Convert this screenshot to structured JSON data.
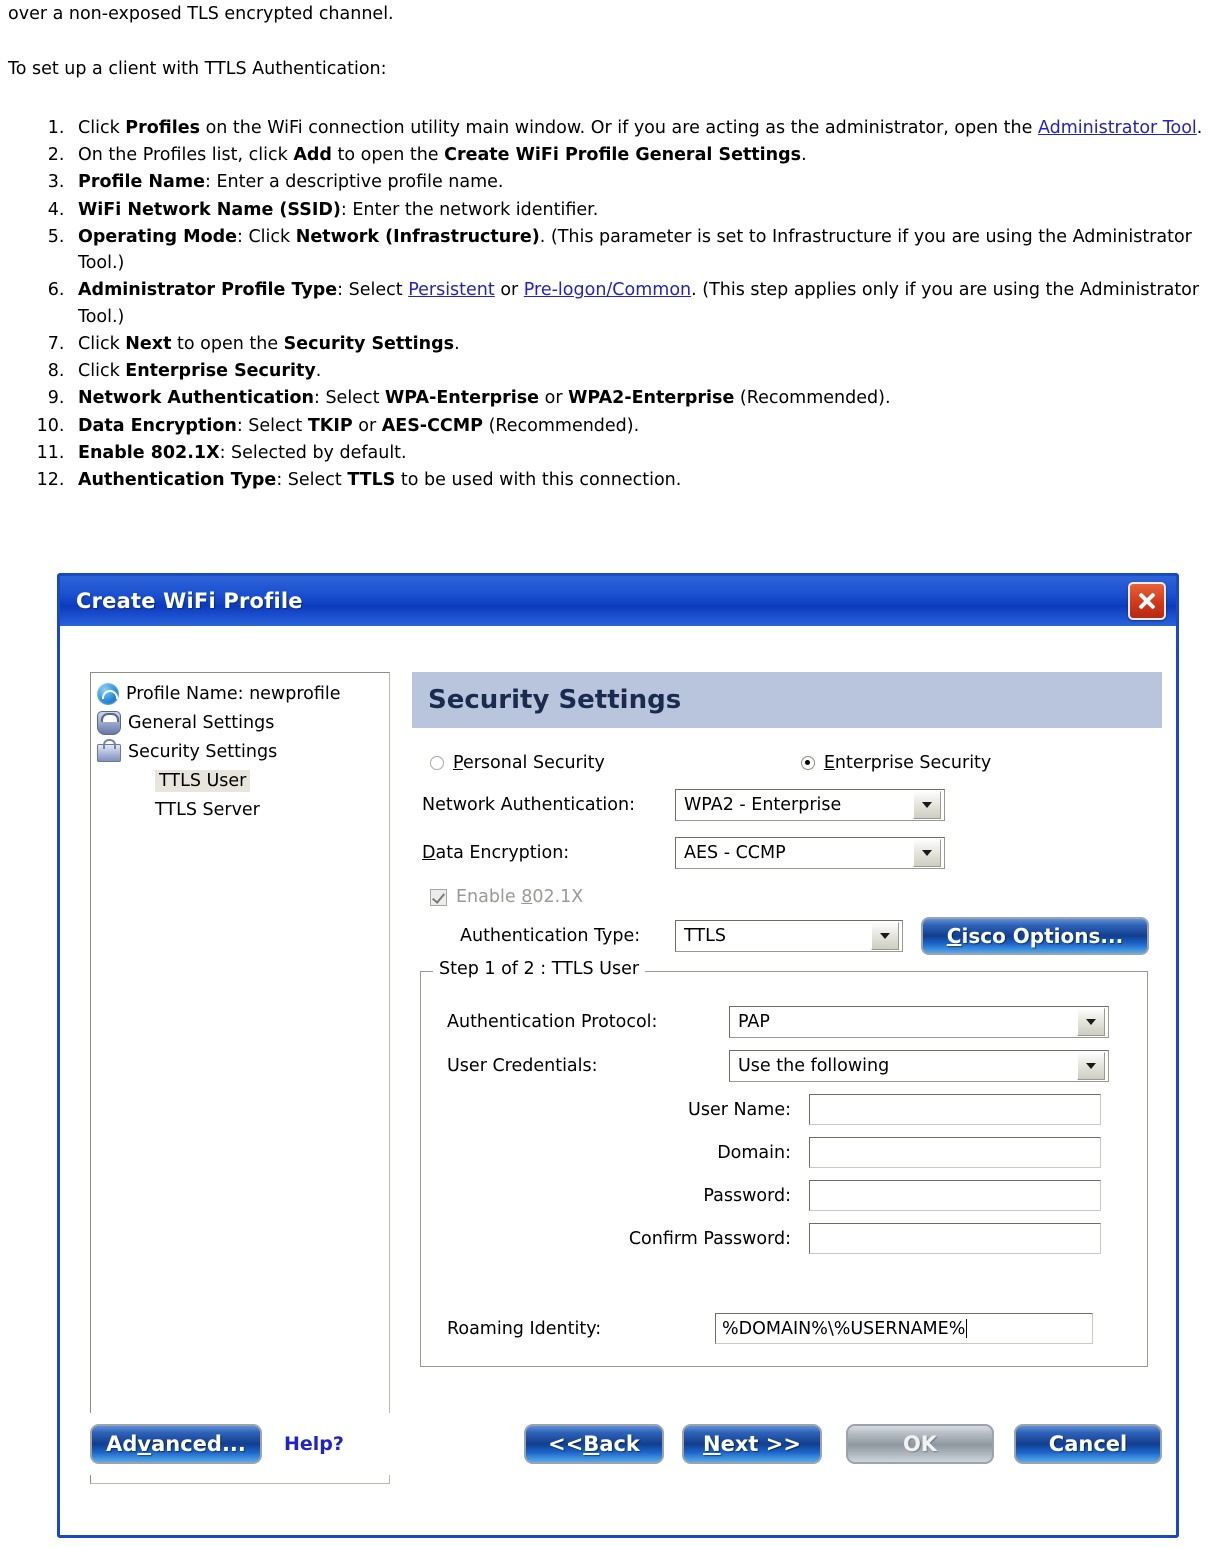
{
  "document": {
    "lead_line_1": "over a non-exposed TLS encrypted channel.",
    "lead_line_2": "To set up a client with TTLS Authentication:",
    "steps": [
      {
        "segments": [
          {
            "t": "Click ",
            "s": "normal"
          },
          {
            "t": "Profiles",
            "s": "bold"
          },
          {
            "t": " on the WiFi connection utility main window. Or if you are acting as the administrator, open the ",
            "s": "normal"
          },
          {
            "t": "Administrator Tool",
            "s": "link"
          },
          {
            "t": ".",
            "s": "normal"
          }
        ]
      },
      {
        "segments": [
          {
            "t": "On the Profiles list, click ",
            "s": "normal"
          },
          {
            "t": "Add",
            "s": "bold"
          },
          {
            "t": " to open the ",
            "s": "normal"
          },
          {
            "t": "Create WiFi Profile General Settings",
            "s": "bold"
          },
          {
            "t": ".",
            "s": "normal"
          }
        ]
      },
      {
        "segments": [
          {
            "t": "Profile Name",
            "s": "bold"
          },
          {
            "t": ": Enter a descriptive profile name.",
            "s": "normal"
          }
        ]
      },
      {
        "segments": [
          {
            "t": "WiFi Network Name (SSID)",
            "s": "bold"
          },
          {
            "t": ": Enter the network identifier.",
            "s": "normal"
          }
        ]
      },
      {
        "segments": [
          {
            "t": "Operating Mode",
            "s": "bold"
          },
          {
            "t": ": Click ",
            "s": "normal"
          },
          {
            "t": "Network (Infrastructure)",
            "s": "bold"
          },
          {
            "t": ". (This parameter is set to Infrastructure if you are using the Administrator Tool.)",
            "s": "normal"
          }
        ]
      },
      {
        "segments": [
          {
            "t": "Administrator Profile Type",
            "s": "bold"
          },
          {
            "t": ": Select ",
            "s": "normal"
          },
          {
            "t": "Persistent",
            "s": "link"
          },
          {
            "t": " or ",
            "s": "normal"
          },
          {
            "t": "Pre-logon/Common",
            "s": "link"
          },
          {
            "t": ". (This step applies only if you are using the Administrator Tool.)",
            "s": "normal"
          }
        ]
      },
      {
        "segments": [
          {
            "t": "Click ",
            "s": "normal"
          },
          {
            "t": "Next",
            "s": "bold"
          },
          {
            "t": " to open the ",
            "s": "normal"
          },
          {
            "t": "Security Settings",
            "s": "bold"
          },
          {
            "t": ".",
            "s": "normal"
          }
        ]
      },
      {
        "segments": [
          {
            "t": "Click ",
            "s": "normal"
          },
          {
            "t": "Enterprise Security",
            "s": "bold"
          },
          {
            "t": ".",
            "s": "normal"
          }
        ]
      },
      {
        "segments": [
          {
            "t": "Network Authentication",
            "s": "bold"
          },
          {
            "t": ": Select ",
            "s": "normal"
          },
          {
            "t": "WPA-Enterprise",
            "s": "bold"
          },
          {
            "t": " or ",
            "s": "normal"
          },
          {
            "t": "WPA2-Enterprise",
            "s": "bold"
          },
          {
            "t": " (Recommended).",
            "s": "normal"
          }
        ]
      },
      {
        "segments": [
          {
            "t": "Data Encryption",
            "s": "bold"
          },
          {
            "t": ": Select ",
            "s": "normal"
          },
          {
            "t": "TKIP",
            "s": "bold"
          },
          {
            "t": " or ",
            "s": "normal"
          },
          {
            "t": "AES-CCMP",
            "s": "bold"
          },
          {
            "t": " (Recommended).",
            "s": "normal"
          }
        ]
      },
      {
        "segments": [
          {
            "t": "Enable 802.1X",
            "s": "bold"
          },
          {
            "t": ": Selected by default.",
            "s": "normal"
          }
        ]
      },
      {
        "segments": [
          {
            "t": "Authentication Type",
            "s": "bold"
          },
          {
            "t": ": Select ",
            "s": "normal"
          },
          {
            "t": "TTLS",
            "s": "bold"
          },
          {
            "t": " to be used with this connection.",
            "s": "normal"
          }
        ]
      }
    ]
  },
  "dialog": {
    "title": "Create WiFi Profile",
    "close_label": "X",
    "tree": [
      {
        "label": "Profile Name: newprofile",
        "icon": "wifi-icon",
        "indent": false,
        "selected": false
      },
      {
        "label": "General Settings",
        "icon": "users-icon",
        "indent": false,
        "selected": false
      },
      {
        "label": "Security Settings",
        "icon": "lock-icon",
        "indent": false,
        "selected": false
      },
      {
        "label": "TTLS User",
        "icon": "none",
        "indent": true,
        "selected": true
      },
      {
        "label": "TTLS Server",
        "icon": "none",
        "indent": true,
        "selected": false
      }
    ],
    "pane": {
      "header_title": "Security Settings",
      "radio_personal": "Personal Security",
      "radio_enterprise": "Enterprise Security",
      "radio_personal_checked": false,
      "radio_enterprise_checked": true,
      "network_auth_label": "Network Authentication:",
      "network_auth_value": "WPA2 - Enterprise",
      "data_encryption_label": "Data Encryption:",
      "data_encryption_value": "AES - CCMP",
      "enable_8021x_label": "Enable 802.1X",
      "enable_8021x_checked": true,
      "auth_type_label": "Authentication Type:",
      "auth_type_value": "TTLS",
      "cisco_options_label": "Cisco Options..."
    },
    "fieldset": {
      "legend": "Step 1 of 2 : TTLS User",
      "auth_protocol_label": "Authentication Protocol:",
      "auth_protocol_value": "PAP",
      "user_credentials_label": "User Credentials:",
      "user_credentials_value": "Use the following",
      "user_name_label": "User Name:",
      "user_name_value": "",
      "domain_label": "Domain:",
      "domain_value": "",
      "password_label": "Password:",
      "password_value": "",
      "confirm_password_label": "Confirm Password:",
      "confirm_password_value": "",
      "roaming_identity_label": "Roaming Identity:",
      "roaming_identity_value": "%DOMAIN%\\%USERNAME%"
    },
    "footer": {
      "advanced_label": "Advanced...",
      "help_label": "Help?",
      "back_label": "<< Back",
      "next_label": "Next >>",
      "ok_label": "OK",
      "cancel_label": "Cancel"
    }
  },
  "colors": {
    "titlebar_blue": "#1a4fd0",
    "dialog_border": "#1a49c4",
    "pane_header": "#b9c5dd",
    "link_blue": "#2222cc",
    "close_red": "#d1391a",
    "selection_beige": "#e8e6dc"
  }
}
